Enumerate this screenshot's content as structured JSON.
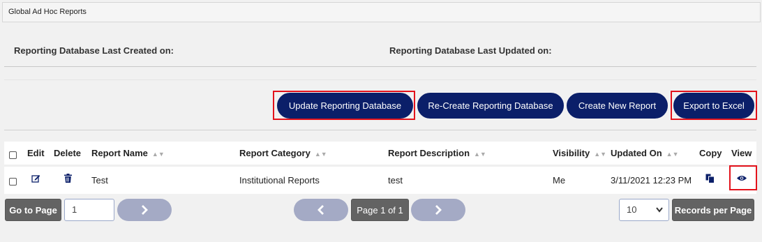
{
  "breadcrumb": "Global Ad Hoc Reports",
  "info": {
    "last_created_label": "Reporting Database Last Created on:",
    "last_updated_label": "Reporting Database Last Updated on:"
  },
  "actions": {
    "update_db": "Update Reporting Database",
    "recreate_db": "Re-Create Reporting Database",
    "create_report": "Create New Report",
    "export_excel": "Export to Excel"
  },
  "table": {
    "headers": {
      "edit": "Edit",
      "delete": "Delete",
      "report_name": "Report Name",
      "report_category": "Report Category",
      "report_description": "Report Description",
      "visibility": "Visibility",
      "updated_on": "Updated On",
      "copy": "Copy",
      "view": "View"
    },
    "rows": [
      {
        "report_name": "Test",
        "report_category": "Institutional Reports",
        "report_description": "test",
        "visibility": "Me",
        "updated_on": "3/11/2021 12:23 PM"
      }
    ]
  },
  "pager": {
    "go_to_page_label": "Go to Page",
    "page_input_value": "1",
    "page_indicator": "Page 1 of 1",
    "records_per_page_value": "10",
    "records_per_page_label": "Records per Page"
  },
  "icons": {
    "edit": "edit-icon",
    "delete": "trash-icon",
    "copy": "copy-icon",
    "view": "eye-icon",
    "next": "chevron-right-icon",
    "prev": "chevron-left-icon",
    "dropdown": "chevron-down-icon"
  },
  "colors": {
    "primary_button": "#0b1f69",
    "highlight": "#e3121b",
    "gray_button": "#636363",
    "pager_pill": "#a4aac5"
  }
}
